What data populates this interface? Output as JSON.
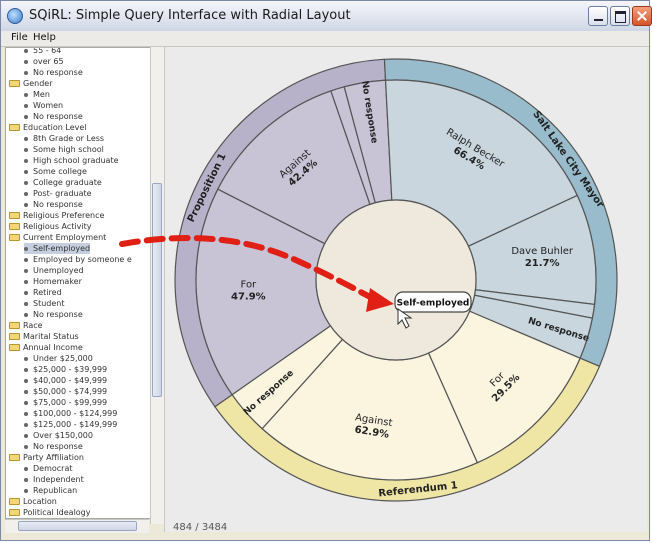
{
  "window": {
    "title": "SQiRL: Simple Query Interface with Radial Layout"
  },
  "menu": {
    "file": "File",
    "help": "Help"
  },
  "tree": {
    "items": [
      {
        "kind": "leaf",
        "indent": 2,
        "label": "55 - 64"
      },
      {
        "kind": "leaf",
        "indent": 2,
        "label": "over 65"
      },
      {
        "kind": "leaf",
        "indent": 2,
        "label": "No response"
      },
      {
        "kind": "folder",
        "indent": 1,
        "label": "Gender"
      },
      {
        "kind": "leaf",
        "indent": 2,
        "label": "Men"
      },
      {
        "kind": "leaf",
        "indent": 2,
        "label": "Women"
      },
      {
        "kind": "leaf",
        "indent": 2,
        "label": "No response"
      },
      {
        "kind": "folder",
        "indent": 1,
        "label": "Education Level"
      },
      {
        "kind": "leaf",
        "indent": 2,
        "label": "8th Grade or Less"
      },
      {
        "kind": "leaf",
        "indent": 2,
        "label": "Some high school"
      },
      {
        "kind": "leaf",
        "indent": 2,
        "label": "High school graduate"
      },
      {
        "kind": "leaf",
        "indent": 2,
        "label": "Some college"
      },
      {
        "kind": "leaf",
        "indent": 2,
        "label": "College graduate"
      },
      {
        "kind": "leaf",
        "indent": 2,
        "label": "Post- graduate"
      },
      {
        "kind": "leaf",
        "indent": 2,
        "label": "No response"
      },
      {
        "kind": "folder",
        "indent": 1,
        "label": "Religious Preference"
      },
      {
        "kind": "folder",
        "indent": 1,
        "label": "Religious Activity"
      },
      {
        "kind": "folder",
        "indent": 1,
        "label": "Current Employment"
      },
      {
        "kind": "leaf",
        "indent": 2,
        "label": "Self-employed",
        "selected": true
      },
      {
        "kind": "leaf",
        "indent": 2,
        "label": "Employed by someone e"
      },
      {
        "kind": "leaf",
        "indent": 2,
        "label": "Unemployed"
      },
      {
        "kind": "leaf",
        "indent": 2,
        "label": "Homemaker"
      },
      {
        "kind": "leaf",
        "indent": 2,
        "label": "Retired"
      },
      {
        "kind": "leaf",
        "indent": 2,
        "label": "Student"
      },
      {
        "kind": "leaf",
        "indent": 2,
        "label": "No response"
      },
      {
        "kind": "folder",
        "indent": 1,
        "label": "Race"
      },
      {
        "kind": "folder",
        "indent": 1,
        "label": "Marital Status"
      },
      {
        "kind": "folder",
        "indent": 1,
        "label": "Annual Income"
      },
      {
        "kind": "leaf",
        "indent": 2,
        "label": "Under $25,000"
      },
      {
        "kind": "leaf",
        "indent": 2,
        "label": "$25,000 - $39,999"
      },
      {
        "kind": "leaf",
        "indent": 2,
        "label": "$40,000 - $49,999"
      },
      {
        "kind": "leaf",
        "indent": 2,
        "label": "$50,000 - $74,999"
      },
      {
        "kind": "leaf",
        "indent": 2,
        "label": "$75,000 - $99,999"
      },
      {
        "kind": "leaf",
        "indent": 2,
        "label": "$100,000 - $124,999"
      },
      {
        "kind": "leaf",
        "indent": 2,
        "label": "$125,000 - $149,999"
      },
      {
        "kind": "leaf",
        "indent": 2,
        "label": "Over $150,000"
      },
      {
        "kind": "leaf",
        "indent": 2,
        "label": "No response"
      },
      {
        "kind": "folder",
        "indent": 1,
        "label": "Party Affiliation"
      },
      {
        "kind": "leaf",
        "indent": 2,
        "label": "Democrat"
      },
      {
        "kind": "leaf",
        "indent": 2,
        "label": "Independent"
      },
      {
        "kind": "leaf",
        "indent": 2,
        "label": "Republican"
      },
      {
        "kind": "folder",
        "indent": 1,
        "label": "Location"
      },
      {
        "kind": "folder",
        "indent": 1,
        "label": "Political Idealogy"
      }
    ]
  },
  "radial": {
    "center_label": "Self-employed",
    "colors": {
      "prop": "#c8c4d6",
      "prop_outer": "#b7b2c9",
      "mayor": "#c9d6de",
      "mayor_outer": "#98bccb",
      "ref": "#fbf5df",
      "ref_outer": "#efe6a5",
      "center": "#efe9dd",
      "arrow": "#e02015",
      "border": "#555555"
    },
    "outer": [
      {
        "id": "proposition",
        "label": "Proposition 1",
        "start": 235,
        "end": 357,
        "color": "prop_outer"
      },
      {
        "id": "mayor",
        "label": "Salt Lake City Mayor",
        "start": 357,
        "end": 113,
        "color": "mayor_outer"
      },
      {
        "id": "referendum",
        "label": "Referendum 1",
        "start": 113,
        "end": 235,
        "color": "ref_outer"
      }
    ],
    "inner": [
      {
        "group": "proposition",
        "label": "Against",
        "pct": "42.4%",
        "start": 297,
        "end": 341,
        "color": "prop"
      },
      {
        "group": "proposition",
        "label": "",
        "pct": "",
        "start": 341,
        "end": 345,
        "color": "prop"
      },
      {
        "group": "proposition",
        "label": "No response",
        "pct": "",
        "start": 345,
        "end": 357,
        "color": "prop"
      },
      {
        "group": "proposition",
        "label": "For",
        "pct": "47.9%",
        "start": 235,
        "end": 297,
        "color": "prop"
      },
      {
        "group": "mayor",
        "label": "Ralph Becker",
        "pct": "66.4%",
        "start": 357,
        "end": 65,
        "color": "mayor"
      },
      {
        "group": "mayor",
        "label": "Dave Buhler",
        "pct": "21.7%",
        "start": 65,
        "end": 97,
        "color": "mayor"
      },
      {
        "group": "mayor",
        "label": "",
        "pct": "",
        "start": 97,
        "end": 101,
        "color": "mayor"
      },
      {
        "group": "mayor",
        "label": "No response",
        "pct": "",
        "start": 101,
        "end": 113,
        "color": "mayor"
      },
      {
        "group": "referendum",
        "label": "For",
        "pct": "29.5%",
        "start": 113,
        "end": 156,
        "color": "ref"
      },
      {
        "group": "referendum",
        "label": "Against",
        "pct": "62.9%",
        "start": 156,
        "end": 222,
        "color": "ref"
      },
      {
        "group": "referendum",
        "label": "No response",
        "pct": "",
        "start": 222,
        "end": 235,
        "color": "ref"
      }
    ]
  },
  "status": {
    "count": "484 / 3484"
  }
}
